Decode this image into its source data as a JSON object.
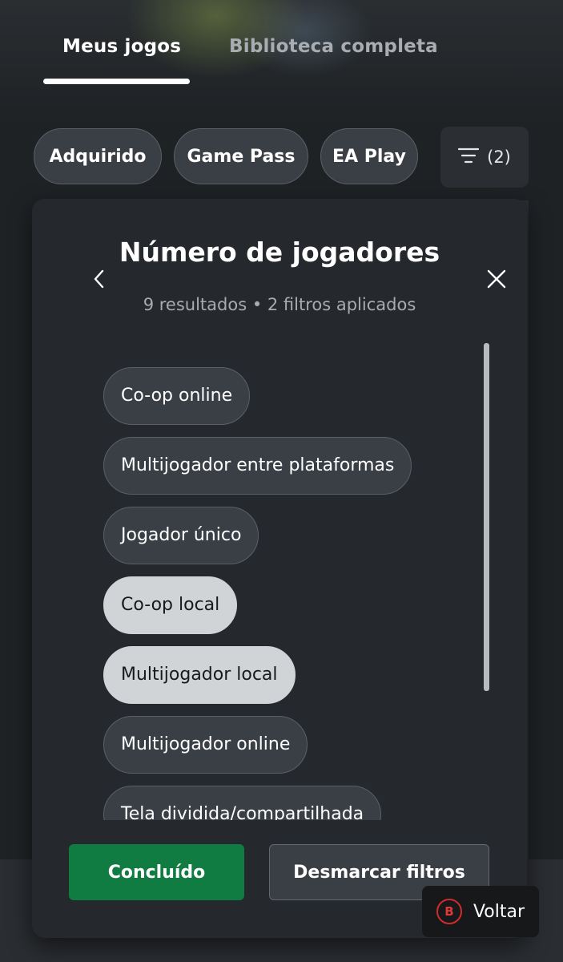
{
  "tabs": [
    {
      "label": "Meus jogos",
      "active": true
    },
    {
      "label": "Biblioteca completa",
      "active": false
    }
  ],
  "chips": [
    {
      "label": "Adquirido"
    },
    {
      "label": "Game Pass"
    },
    {
      "label": "EA Play"
    }
  ],
  "filter_button": {
    "icon": "filter-lines-icon",
    "count_label": "(2)"
  },
  "panel": {
    "title": "Número de jogadores",
    "subtitle": "9 resultados • 2 filtros aplicados",
    "back_icon": "chevron-left-icon",
    "close_icon": "close-icon",
    "options": [
      {
        "label": "Co-op online",
        "selected": false
      },
      {
        "label": "Multijogador entre plataformas",
        "selected": false
      },
      {
        "label": "Jogador único",
        "selected": false
      },
      {
        "label": "Co-op local",
        "selected": true
      },
      {
        "label": "Multijogador local",
        "selected": true
      },
      {
        "label": "Multijogador online",
        "selected": false
      },
      {
        "label": "Tela dividida/compartilhada",
        "selected": false
      }
    ],
    "done_label": "Concluído",
    "clear_label": "Desmarcar filtros"
  },
  "back_hint": {
    "key": "B",
    "label": "Voltar"
  },
  "colors": {
    "accent_green": "#107c41",
    "selected_chip": "#d1d4d7",
    "b_button_red": "#d42a2a"
  }
}
